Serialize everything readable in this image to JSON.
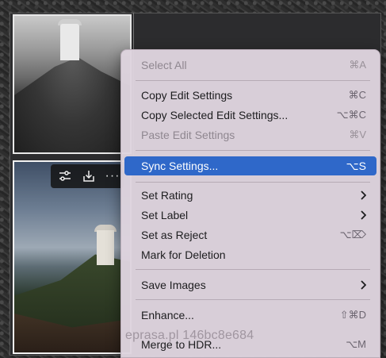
{
  "menu": {
    "items": [
      {
        "label": "Select All",
        "shortcut": "⌘A",
        "state": "disabled"
      },
      {
        "label": "Copy Edit Settings",
        "shortcut": "⌘C",
        "state": "enabled"
      },
      {
        "label": "Copy Selected Edit Settings...",
        "shortcut": "⌥⌘C",
        "state": "enabled"
      },
      {
        "label": "Paste Edit Settings",
        "shortcut": "⌘V",
        "state": "disabled"
      },
      {
        "label": "Sync Settings...",
        "shortcut": "⌥S",
        "state": "highlighted"
      },
      {
        "label": "Set Rating",
        "submenu": true,
        "state": "enabled"
      },
      {
        "label": "Set Label",
        "submenu": true,
        "state": "enabled"
      },
      {
        "label": "Set as Reject",
        "shortcut": "⌥⌦",
        "state": "enabled"
      },
      {
        "label": "Mark for Deletion",
        "state": "enabled"
      },
      {
        "label": "Save Images",
        "submenu": true,
        "state": "enabled"
      },
      {
        "label": "Enhance...",
        "shortcut": "⇧⌘D",
        "state": "enabled"
      },
      {
        "label": "Merge to HDR...",
        "shortcut": "⌥M",
        "state": "enabled"
      }
    ]
  },
  "thumbnail_toolbar": {
    "icons": [
      "sliders-icon",
      "download-icon",
      "more-icon"
    ],
    "more_glyph": "···"
  },
  "watermark": "eprasa.pl 146bc8e684",
  "colors": {
    "menu_background": "#ded4de",
    "highlight": "#2f68c9",
    "disabled_text": "#8f8790"
  }
}
